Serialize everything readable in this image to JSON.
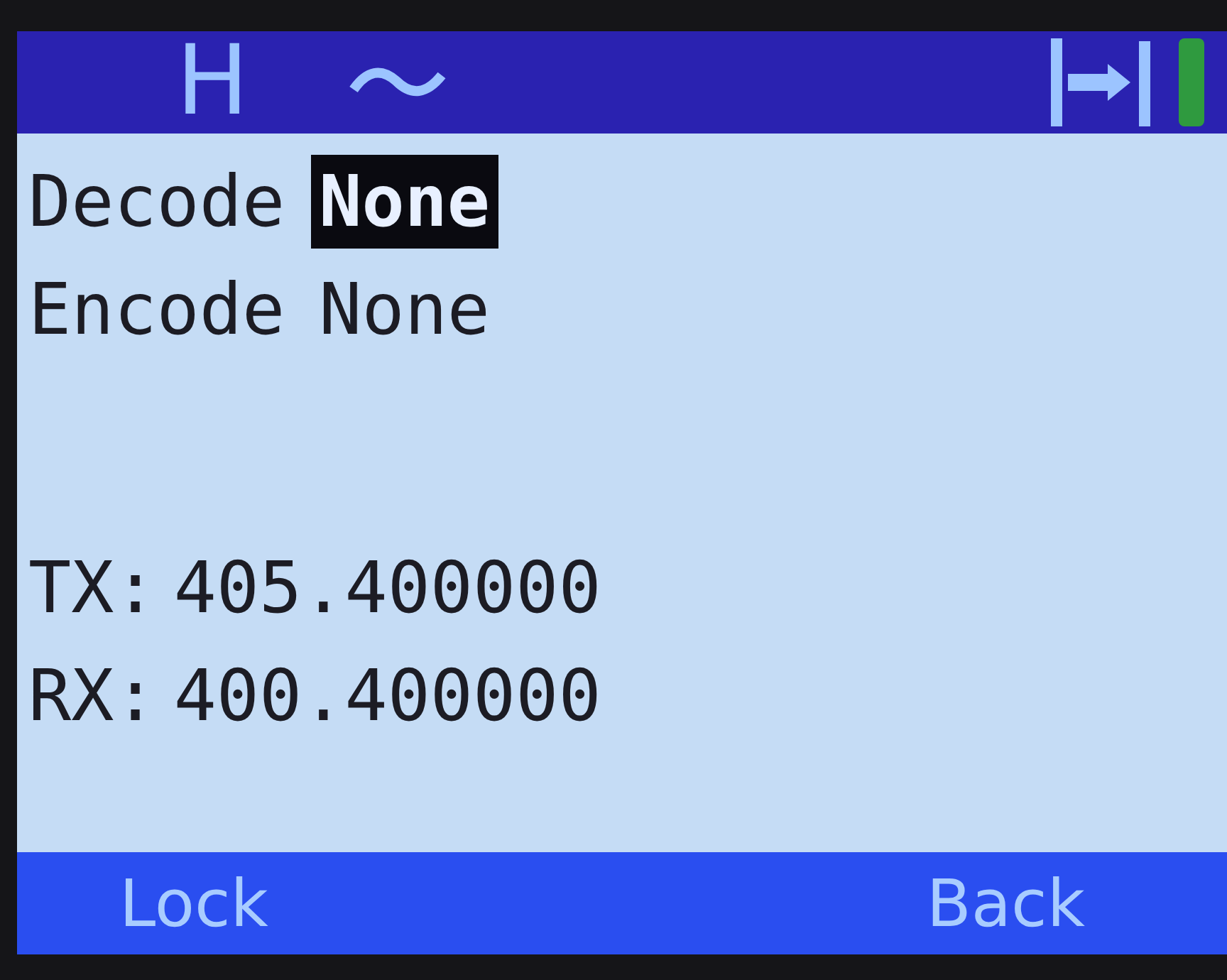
{
  "header": {
    "mode": "H"
  },
  "settings": [
    {
      "label": "Decode",
      "value": "None",
      "selected": true
    },
    {
      "label": "Encode",
      "value": "None",
      "selected": false
    }
  ],
  "frequencies": [
    {
      "label": "TX:",
      "value": "405.400000"
    },
    {
      "label": "RX:",
      "value": "400.400000"
    }
  ],
  "softkeys": [
    "Lock",
    "Back"
  ]
}
